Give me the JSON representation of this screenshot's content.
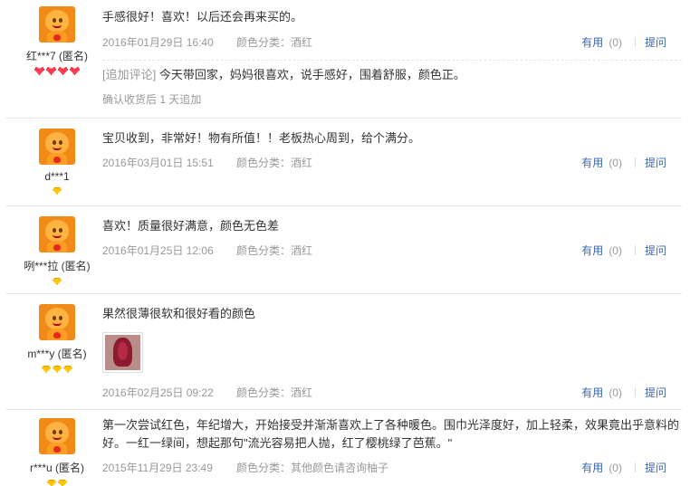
{
  "actions": {
    "useful_label": "有用",
    "ask_label": "提问"
  },
  "reviews": [
    {
      "user": "红***7 (匿名)",
      "text": "手感很好！喜欢！以后还会再来买的。",
      "date": "2016年01月29日 16:40",
      "spec": "颜色分类：酒红",
      "useful_count": "(0)",
      "append_tag": "[追加评论]",
      "append_text": "今天带回家，妈妈很喜欢，说手感好，围着舒服，颜色正。",
      "append_note": "确认收货后 1 天追加",
      "badge": "red-heart-icon"
    },
    {
      "user": "d***1",
      "text": "宝贝收到，非常好！物有所值！！老板热心周到，给个满分。",
      "date": "2016年03月01日 15:51",
      "spec": "颜色分类：酒红",
      "useful_count": "(0)",
      "badge": "gold-diamond-icon"
    },
    {
      "user": "咧***拉 (匿名)",
      "text": "喜欢！质量很好满意，颜色无色差",
      "date": "2016年01月25日 12:06",
      "spec": "颜色分类：酒红",
      "useful_count": "(0)",
      "badge": "gold-diamond-icon"
    },
    {
      "user": "m***y (匿名)",
      "text": "果然很薄很软和很好看的颜色",
      "date": "2016年02月25日 09:22",
      "spec": "颜色分类：酒红",
      "useful_count": "(0)",
      "badge": "gold-diamond-icon"
    },
    {
      "user": "r***u (匿名)",
      "text": "第一次尝试红色，年纪增大，开始接受并渐渐喜欢上了各种暖色。围巾光泽度好，加上轻柔，效果竟出乎意料的好。一红一绿间，想起那句\"流光容易把人抛，红了樱桃绿了芭蕉。\"",
      "date": "2015年11月29日 23:49",
      "spec": "颜色分类：其他颜色请咨询柚子",
      "useful_count": "(0)",
      "badge": "gold-diamond-icon"
    }
  ],
  "colors": {
    "link": "#3c66ad",
    "muted": "#999999",
    "text": "#333333"
  }
}
